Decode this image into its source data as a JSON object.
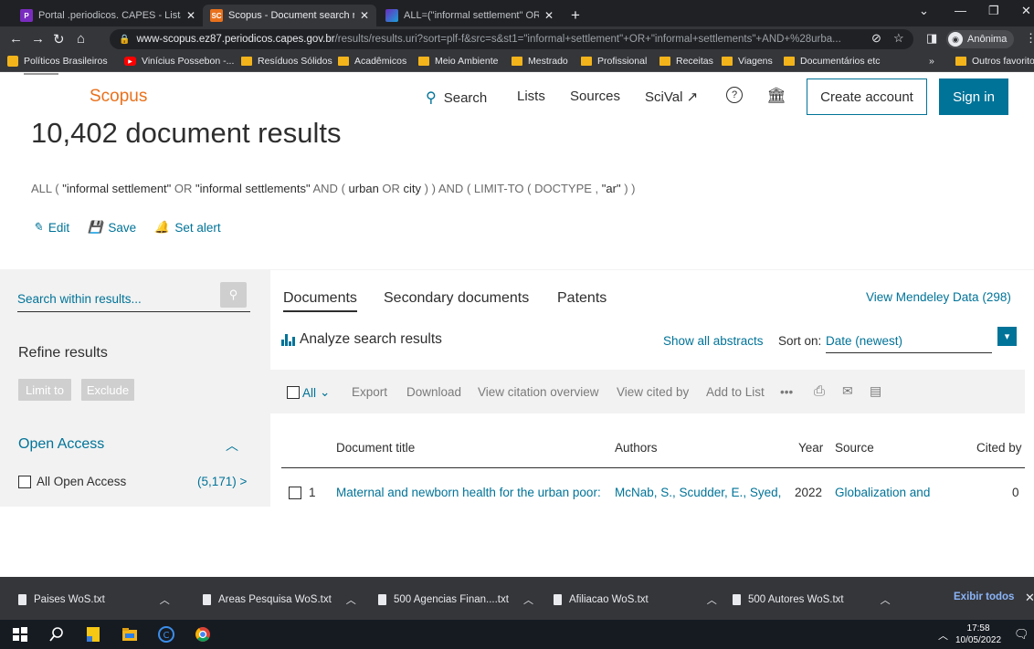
{
  "browser": {
    "tabs": [
      {
        "title": "Portal .periodicos. CAPES - Lista d",
        "close": "✕",
        "favicon": "P"
      },
      {
        "title": "Scopus - Document search results",
        "close": "✕",
        "favicon": "SC"
      },
      {
        "title": "ALL=(\"informal settlement\" OR \"i",
        "close": "✕",
        "favicon": ""
      }
    ],
    "new_tab": "+",
    "url_host": "www-scopus.ez87.periodicos.capes.gov.br",
    "url_path": "/results/results.uri?sort=plf-f&src=s&st1=\"informal+settlement\"+OR+\"informal+settlements\"+AND+%28urba...",
    "incognito_label": "Anônima",
    "bookmarks": [
      {
        "label": "Políticos Brasileiros"
      },
      {
        "label": "Vinícius Possebon -..."
      },
      {
        "label": "Resíduos Sólidos"
      },
      {
        "label": "Acadêmicos"
      },
      {
        "label": "Meio Ambiente"
      },
      {
        "label": "Mestrado"
      },
      {
        "label": "Profissional"
      },
      {
        "label": "Receitas"
      },
      {
        "label": "Viagens"
      },
      {
        "label": "Documentários etc"
      }
    ],
    "bookmarks_overflow": "»",
    "other_bookmarks": "Outros favoritos"
  },
  "scopus": {
    "brand": "Scopus",
    "nav": {
      "search": "Search",
      "lists": "Lists",
      "sources": "Sources",
      "scival": "SciVal ↗",
      "help_glyph": "?"
    },
    "create_account": "Create account",
    "sign_in": "Sign in",
    "results_title": "10,402 document results",
    "query": {
      "all": "ALL (",
      "term1": "\"informal settlement\"",
      "or1": "OR",
      "term2": "\"informal settlements\"",
      "and1": "AND",
      "paren1": "(",
      "urban": "urban",
      "or2": "OR",
      "city": "city",
      "close": ") )",
      "and2": "AND",
      "limit": "( LIMIT-TO ( DOCTYPE ,",
      "ar": "\"ar\"",
      "end": ") )"
    },
    "actions": {
      "edit": "Edit",
      "save": "Save",
      "set_alert": "Set alert"
    },
    "sidebar": {
      "search_placeholder": "Search within results...",
      "refine": "Refine results",
      "limit_to": "Limit to",
      "exclude": "Exclude",
      "open_access": "Open Access",
      "all_open_access": "All Open Access",
      "all_open_access_count": "(5,171) >"
    },
    "tabs": {
      "documents": "Documents",
      "secondary": "Secondary documents",
      "patents": "Patents"
    },
    "mendeley": "View Mendeley Data (298)",
    "analyze": "Analyze search results",
    "show_abstracts": "Show all abstracts",
    "sort_label": "Sort on:",
    "sort_value": "Date (newest)",
    "toolbar": {
      "all": "All",
      "export": "Export",
      "download": "Download",
      "citation_overview": "View citation overview",
      "cited_by": "View cited by",
      "add_to_list": "Add to List",
      "more": "•••"
    },
    "columns": {
      "title": "Document title",
      "authors": "Authors",
      "year": "Year",
      "source": "Source",
      "cited_by": "Cited by"
    },
    "rows": [
      {
        "index": "1",
        "title": "Maternal and newborn health for the urban poor:",
        "authors": "McNab, S., Scudder, E., Syed,",
        "year": "2022",
        "source": "Globalization and",
        "cited": "0"
      }
    ]
  },
  "downloads": {
    "items": [
      {
        "name": "Paises WoS.txt"
      },
      {
        "name": "Areas Pesquisa WoS.txt"
      },
      {
        "name": "500 Agencias Finan....txt"
      },
      {
        "name": "Afiliacao WoS.txt"
      },
      {
        "name": "500 Autores WoS.txt"
      }
    ],
    "show_all": "Exibir todos",
    "close": "✕"
  },
  "taskbar": {
    "time": "17:58",
    "date": "10/05/2022"
  },
  "colors": {
    "scopus_orange": "#e9711c",
    "scopus_teal": "#007398",
    "chrome_dark": "#202124"
  }
}
